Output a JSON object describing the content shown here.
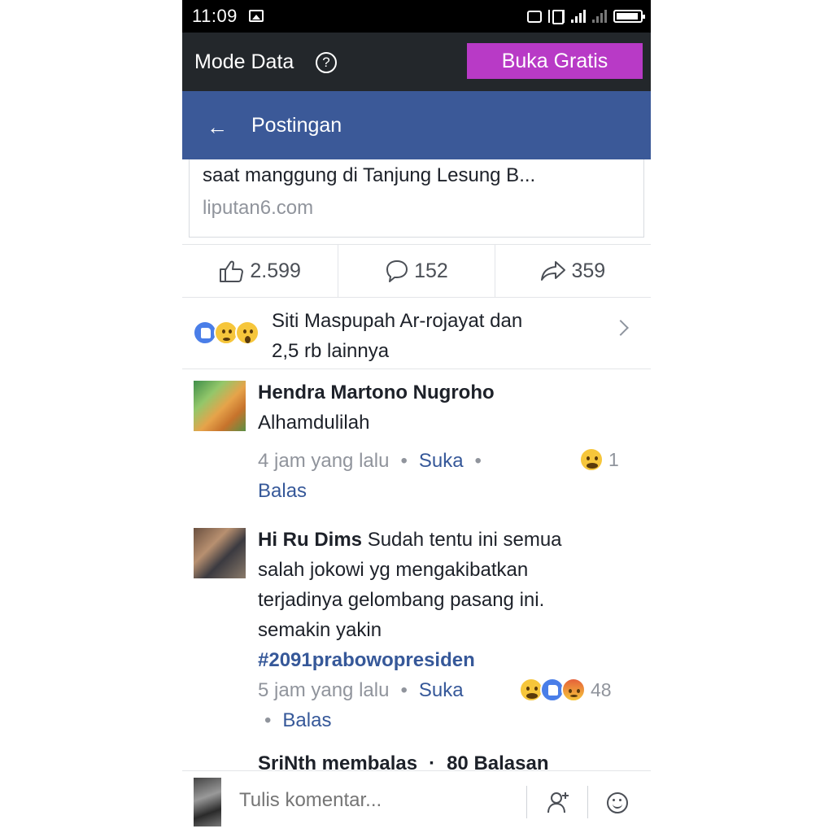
{
  "status_bar": {
    "time": "11:09"
  },
  "data_bar": {
    "mode_label": "Mode Data",
    "help_symbol": "?",
    "free_button": "Buka Gratis"
  },
  "header": {
    "title": "Postingan"
  },
  "link_preview": {
    "description": "saat manggung di Tanjung Lesung B...",
    "source": "liputan6.com"
  },
  "actions": {
    "likes": "2.599",
    "comments": "152",
    "shares": "359"
  },
  "reactions": {
    "summary_line1": "Siti Maspupah Ar-rojayat dan",
    "summary_line2": "2,5 rb lainnya",
    "icons": [
      "like-icon",
      "sad-icon",
      "wow-icon"
    ]
  },
  "comments": [
    {
      "author": "Hendra Martono Nugroho",
      "text": "Alhamdulilah",
      "time": "4 jam yang lalu",
      "like_label": "Suka",
      "reply_label": "Balas",
      "reaction_count": "1"
    },
    {
      "author": "Hi Ru Dims",
      "text_1": "Sudah tentu ini semua",
      "text_2": "salah jokowi yg mengakibatkan",
      "text_3": "terjadinya gelombang pasang ini.",
      "text_4": "semakin yakin",
      "hashtag": "#2091prabowopresiden",
      "time": "5 jam yang lalu",
      "like_label": "Suka",
      "reply_label": "Balas",
      "reaction_count": "48"
    }
  ],
  "reply_summary": {
    "text": "SriNth membalas",
    "count": "80 Balasan"
  },
  "composer": {
    "placeholder": "Tulis komentar..."
  },
  "colors": {
    "facebook_blue": "#3b5998",
    "free_button": "#b83ac6",
    "link_blue": "#365899"
  }
}
